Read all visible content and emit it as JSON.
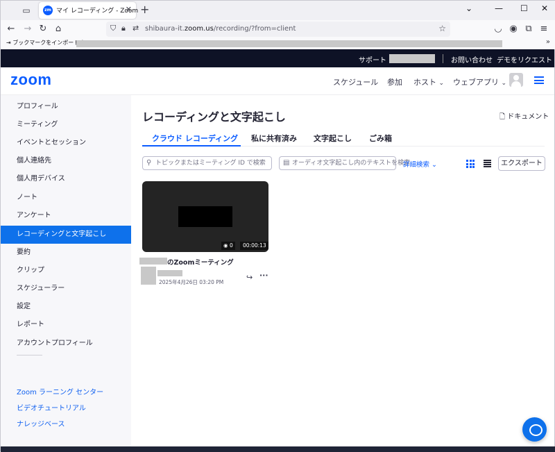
{
  "browser": {
    "tab_title": "マイ レコーディング - Zoom",
    "tab_favicon": "zm",
    "url_prefix": "shibaura-it.",
    "url_domain": "zoom.us",
    "url_path": "/recording/?from=client",
    "bookmark_import": "ブックマークをインポートす..."
  },
  "topbar": {
    "support": "サポート",
    "contact": "お問い合わせ",
    "demo": "デモをリクエスト"
  },
  "header": {
    "logo": "zoom",
    "nav": [
      "スケジュール",
      "参加",
      "ホスト",
      "ウェブアプリ"
    ]
  },
  "sidebar": {
    "items": [
      {
        "label": "プロフィール",
        "active": false
      },
      {
        "label": "ミーティング",
        "active": false
      },
      {
        "label": "イベントとセッション",
        "active": false
      },
      {
        "label": "個人連絡先",
        "active": false
      },
      {
        "label": "個人用デバイス",
        "active": false
      },
      {
        "label": "ノート",
        "active": false
      },
      {
        "label": "アンケート",
        "active": false
      },
      {
        "label": "レコーディングと文字起こし",
        "active": true
      },
      {
        "label": "要約",
        "active": false
      },
      {
        "label": "クリップ",
        "active": false
      },
      {
        "label": "スケジューラー",
        "active": false
      },
      {
        "label": "設定",
        "active": false
      },
      {
        "label": "レポート",
        "active": false
      },
      {
        "label": "アカウントプロフィール",
        "active": false
      }
    ],
    "links": [
      "Zoom ラーニング センター",
      "ビデオチュートリアル",
      "ナレッジベース"
    ]
  },
  "main": {
    "title": "レコーディングと文字起こし",
    "doc_link": "ドキュメント",
    "tabs": [
      "クラウド レコーディング",
      "私に共有済み",
      "文字起こし",
      "ごみ箱"
    ],
    "search_topic_placeholder": "トピックまたはミーティング ID で検索",
    "search_transcript_placeholder": "オーディオ文字起こし内のテキストを検索",
    "advanced_search": "詳細検索",
    "export": "エクスポート"
  },
  "recording": {
    "title_suffix": "のZoomミーティング",
    "views": "0",
    "duration": "00:00:13",
    "date": "2025年4月26日 03:20 PM"
  },
  "colors": {
    "brand": "#0b5cff",
    "active_sidebar": "#0e71eb",
    "topstrip": "#0e1226"
  }
}
